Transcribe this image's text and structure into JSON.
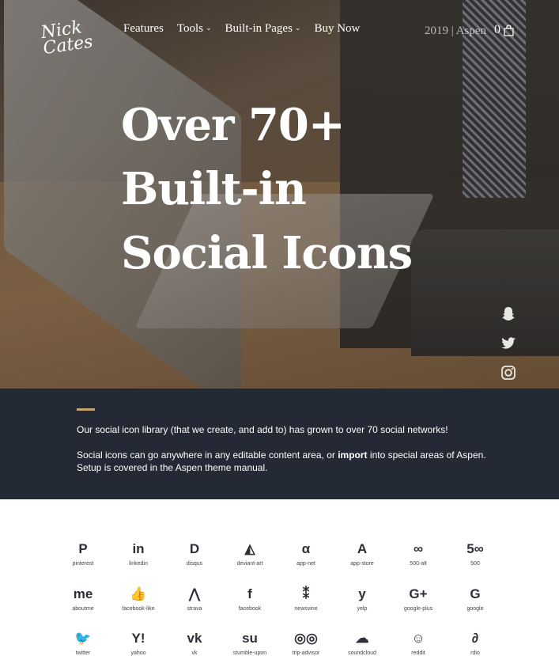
{
  "header": {
    "logo": "Nick Cates",
    "nav": [
      {
        "label": "Features",
        "caret": false
      },
      {
        "label": "Tools",
        "caret": true
      },
      {
        "label": "Built-in Pages",
        "caret": true
      },
      {
        "label": "Buy Now",
        "caret": false
      }
    ],
    "right_link": "2019 | Aspen",
    "cart_count": "0"
  },
  "hero": {
    "headline_lines": [
      "Over 70+",
      "Built-in",
      "Social Icons"
    ]
  },
  "social_rail": [
    "snapchat-icon",
    "twitter-icon",
    "instagram-icon",
    "pinterest-icon"
  ],
  "band": {
    "p1": "Our social icon library (that we create, and add to) has grown to over 70 social networks!",
    "p2_before": "Social icons can go anywhere in any editable content area, or ",
    "p2_bold": "import",
    "p2_after": " into special areas of Aspen. Setup is covered in the Aspen theme manual."
  },
  "icons": [
    {
      "glyph": "P",
      "label": "pinterest",
      "icon": "pinterest-icon"
    },
    {
      "glyph": "in",
      "label": "linkedin",
      "icon": "linkedin-icon"
    },
    {
      "glyph": "D",
      "label": "disqus",
      "icon": "disqus-icon"
    },
    {
      "glyph": "◭",
      "label": "deviant-art",
      "icon": "deviant-art-icon"
    },
    {
      "glyph": "α",
      "label": "app-net",
      "icon": "app-net-icon"
    },
    {
      "glyph": "A",
      "label": "app-store",
      "icon": "app-store-icon"
    },
    {
      "glyph": "∞",
      "label": "500-alt",
      "icon": "500-alt-icon"
    },
    {
      "glyph": "5∞",
      "label": "500",
      "icon": "500-icon"
    },
    {
      "glyph": "me",
      "label": "aboutme",
      "icon": "aboutme-icon"
    },
    {
      "glyph": "👍",
      "label": "facebook-like",
      "icon": "facebook-like-icon"
    },
    {
      "glyph": "⋀",
      "label": "strava",
      "icon": "strava-icon"
    },
    {
      "glyph": "f",
      "label": "facebook",
      "icon": "facebook-icon"
    },
    {
      "glyph": "⁑",
      "label": "newsvine",
      "icon": "newsvine-icon"
    },
    {
      "glyph": "y",
      "label": "yelp",
      "icon": "yelp-icon"
    },
    {
      "glyph": "G+",
      "label": "google-plus",
      "icon": "google-plus-icon"
    },
    {
      "glyph": "G",
      "label": "google",
      "icon": "google-icon"
    },
    {
      "glyph": "🐦",
      "label": "twitter",
      "icon": "twitter-icon"
    },
    {
      "glyph": "Y!",
      "label": "yahoo",
      "icon": "yahoo-icon"
    },
    {
      "glyph": "vk",
      "label": "vk",
      "icon": "vk-icon"
    },
    {
      "glyph": "su",
      "label": "stumble-upon",
      "icon": "stumble-upon-icon"
    },
    {
      "glyph": "◎◎",
      "label": "trip-advisor",
      "icon": "trip-advisor-icon"
    },
    {
      "glyph": "☁",
      "label": "soundcloud",
      "icon": "soundcloud-icon"
    },
    {
      "glyph": "☺",
      "label": "reddit",
      "icon": "reddit-icon"
    },
    {
      "glyph": "∂",
      "label": "rdio",
      "icon": "rdio-icon"
    }
  ]
}
